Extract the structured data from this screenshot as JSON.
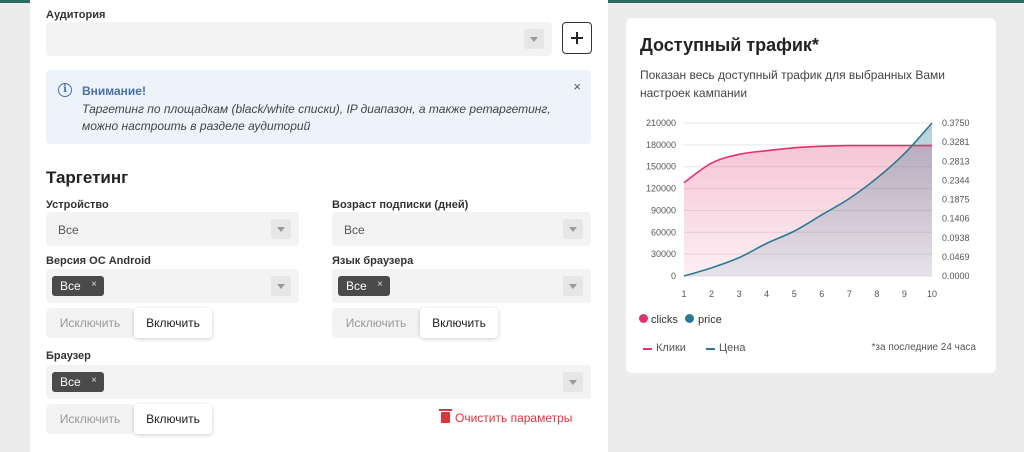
{
  "audience": {
    "label": "Аудитория",
    "value": ""
  },
  "alert": {
    "title": "Внимание!",
    "text": "Таргетинг по площадкам (black/white списки), IP диапазон, а также ретаргетинг, можно настроить в разделе аудиторий",
    "close": "×"
  },
  "targeting": {
    "title": "Таргетинг",
    "device": {
      "label": "Устройство",
      "value": "Все"
    },
    "subscription_age": {
      "label": "Возраст подписки (дней)",
      "value": "Все"
    },
    "android_version": {
      "label": "Версия ОС Android",
      "chip": "Все",
      "exclude": "Исключить",
      "include": "Включить"
    },
    "browser_language": {
      "label": "Язык браузера",
      "chip": "Все",
      "exclude": "Исключить",
      "include": "Включить"
    },
    "browser": {
      "label": "Браузер",
      "chip": "Все",
      "exclude": "Исключить",
      "include": "Включить"
    },
    "chip_remove": "×",
    "clear": "Очистить параметры"
  },
  "traffic": {
    "title": "Доступный трафик*",
    "subtitle": "Показан весь доступный трафик для выбранных Вами настроек кампании",
    "footnote": "*за последние 24 часа",
    "legend": {
      "clicks": "clicks",
      "price": "price"
    },
    "line_legend": {
      "clicks": "Клики",
      "price": "Цена"
    }
  },
  "colors": {
    "clicks": "#e0336b",
    "price": "#2c7a92",
    "clear": "#d9363e",
    "alert_title": "#4a6fa5"
  },
  "chart_data": {
    "type": "area",
    "x": [
      1,
      2,
      3,
      4,
      5,
      6,
      7,
      8,
      9,
      10
    ],
    "left_ticks": [
      "210000",
      "180000",
      "150000",
      "120000",
      "90000",
      "60000",
      "30000",
      "0"
    ],
    "right_ticks": [
      "0.3750",
      "0.3281",
      "0.2813",
      "0.2344",
      "0.1875",
      "0.1406",
      "0.0938",
      "0.0469",
      "0.0000"
    ],
    "ylim_left": [
      0,
      210000
    ],
    "ylim_right": [
      0,
      0.375
    ],
    "grid": true,
    "series": [
      {
        "name": "clicks",
        "axis": "left",
        "values": [
          128000,
          155000,
          167000,
          172000,
          176000,
          178000,
          179000,
          179000,
          179000,
          179000
        ]
      },
      {
        "name": "price",
        "axis": "right",
        "values": [
          0.0,
          0.02,
          0.045,
          0.08,
          0.11,
          0.15,
          0.19,
          0.24,
          0.3,
          0.375
        ]
      }
    ]
  }
}
